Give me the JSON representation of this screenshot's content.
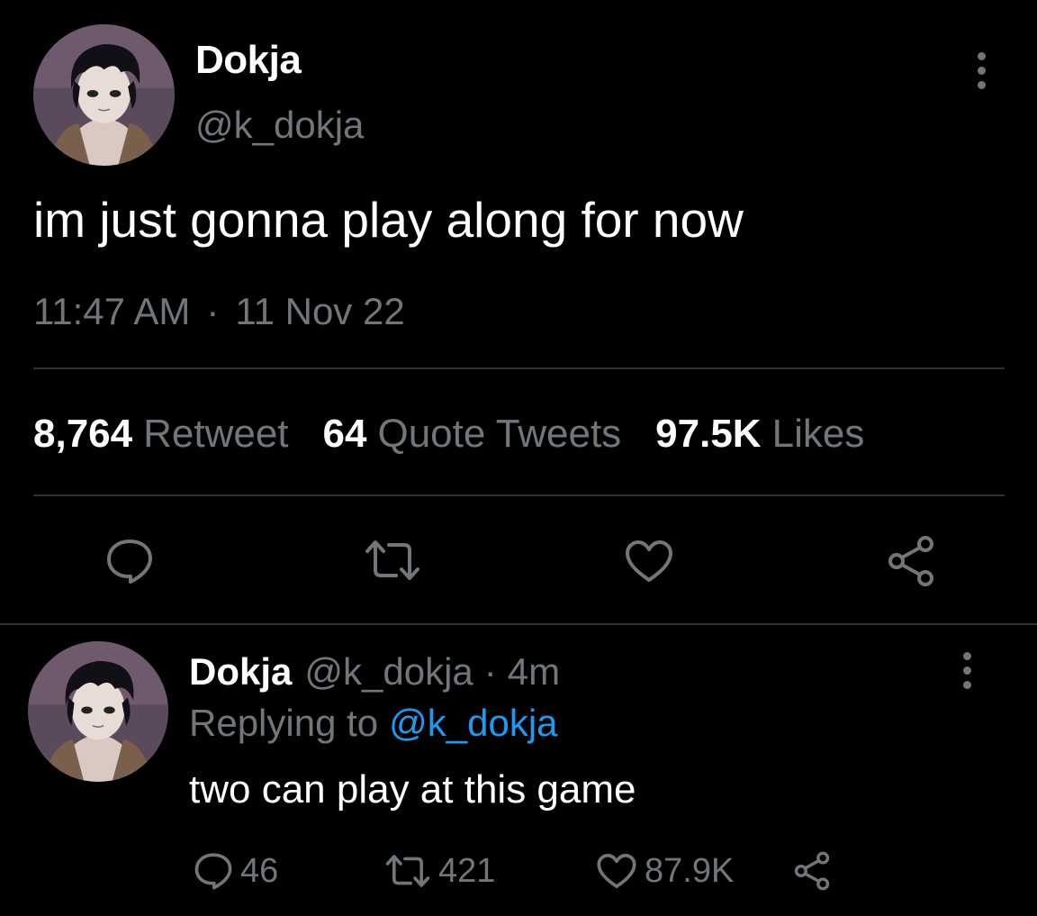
{
  "main_tweet": {
    "author_name": "Dokja",
    "author_handle": "@k_dokja",
    "text": "im just gonna play along for now",
    "time": "11:47 AM",
    "separator": "·",
    "date": "11 Nov 22",
    "stats": [
      {
        "value": "8,764",
        "label": "Retweet"
      },
      {
        "value": "64",
        "label": "Quote Tweets"
      },
      {
        "value": "97.5K",
        "label": "Likes"
      }
    ],
    "actions": [
      "reply-icon",
      "retweet-icon",
      "like-icon",
      "share-icon"
    ]
  },
  "reply_tweet": {
    "author_name": "Dokja",
    "author_handle": "@k_dokja",
    "separator": "·",
    "time_ago": "4m",
    "replying_prefix": "Replying to",
    "replying_to": "@k_dokja",
    "text": "two can play at this game",
    "counts": {
      "replies": "46",
      "retweets": "421",
      "likes": "87.9K"
    }
  },
  "colors": {
    "background": "#000000",
    "primary_text": "#ffffff",
    "secondary_text": "#71767b",
    "accent": "#1d9bf0",
    "divider": "#2f3336"
  }
}
